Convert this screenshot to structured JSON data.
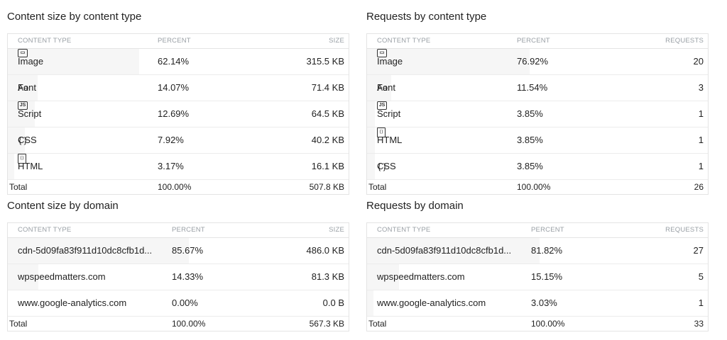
{
  "content_size_by_type": {
    "title": "Content size by content type",
    "headers": {
      "type": "CONTENT TYPE",
      "percent": "PERCENT",
      "value": "SIZE"
    },
    "rows": [
      {
        "icon": "image-icon",
        "label": "Image",
        "percent": "62.14%",
        "value": "315.5 KB",
        "share": 0.6214
      },
      {
        "icon": "font-icon",
        "label": "Font",
        "percent": "14.07%",
        "value": "71.4 KB",
        "share": 0.1407
      },
      {
        "icon": "script-icon",
        "label": "Script",
        "percent": "12.69%",
        "value": "64.5 KB",
        "share": 0.1269
      },
      {
        "icon": "css-icon",
        "label": "CSS",
        "percent": "7.92%",
        "value": "40.2 KB",
        "share": 0.0792
      },
      {
        "icon": "html-icon",
        "label": "HTML",
        "percent": "3.17%",
        "value": "16.1 KB",
        "share": 0.0317
      }
    ],
    "total": {
      "label": "Total",
      "percent": "100.00%",
      "value": "507.8 KB"
    }
  },
  "requests_by_type": {
    "title": "Requests by content type",
    "headers": {
      "type": "CONTENT TYPE",
      "percent": "PERCENT",
      "value": "REQUESTS"
    },
    "rows": [
      {
        "icon": "image-icon",
        "label": "Image",
        "percent": "76.92%",
        "value": "20",
        "share": 0.7692
      },
      {
        "icon": "font-icon",
        "label": "Font",
        "percent": "11.54%",
        "value": "3",
        "share": 0.1154
      },
      {
        "icon": "script-icon",
        "label": "Script",
        "percent": "3.85%",
        "value": "1",
        "share": 0.0385
      },
      {
        "icon": "html-icon",
        "label": "HTML",
        "percent": "3.85%",
        "value": "1",
        "share": 0.0385
      },
      {
        "icon": "css-icon",
        "label": "CSS",
        "percent": "3.85%",
        "value": "1",
        "share": 0.0385
      }
    ],
    "total": {
      "label": "Total",
      "percent": "100.00%",
      "value": "26"
    }
  },
  "content_size_by_domain": {
    "title": "Content size by domain",
    "headers": {
      "type": "CONTENT TYPE",
      "percent": "PERCENT",
      "value": "SIZE"
    },
    "rows": [
      {
        "label": "cdn-5d09fa83f911d10dc8cfb1d...",
        "percent": "85.67%",
        "value": "486.0 KB",
        "share": 0.8567
      },
      {
        "label": "wpspeedmatters.com",
        "percent": "14.33%",
        "value": "81.3 KB",
        "share": 0.1433
      },
      {
        "label": "www.google-analytics.com",
        "percent": "0.00%",
        "value": "0.0 B",
        "share": 0.0
      }
    ],
    "total": {
      "label": "Total",
      "percent": "100.00%",
      "value": "567.3 KB"
    }
  },
  "requests_by_domain": {
    "title": "Requests by domain",
    "headers": {
      "type": "CONTENT TYPE",
      "percent": "PERCENT",
      "value": "REQUESTS"
    },
    "rows": [
      {
        "label": "cdn-5d09fa83f911d10dc8cfb1d...",
        "percent": "81.82%",
        "value": "27",
        "share": 0.8182
      },
      {
        "label": "wpspeedmatters.com",
        "percent": "15.15%",
        "value": "5",
        "share": 0.1515
      },
      {
        "label": "www.google-analytics.com",
        "percent": "3.03%",
        "value": "1",
        "share": 0.0303
      }
    ],
    "total": {
      "label": "Total",
      "percent": "100.00%",
      "value": "33"
    }
  }
}
